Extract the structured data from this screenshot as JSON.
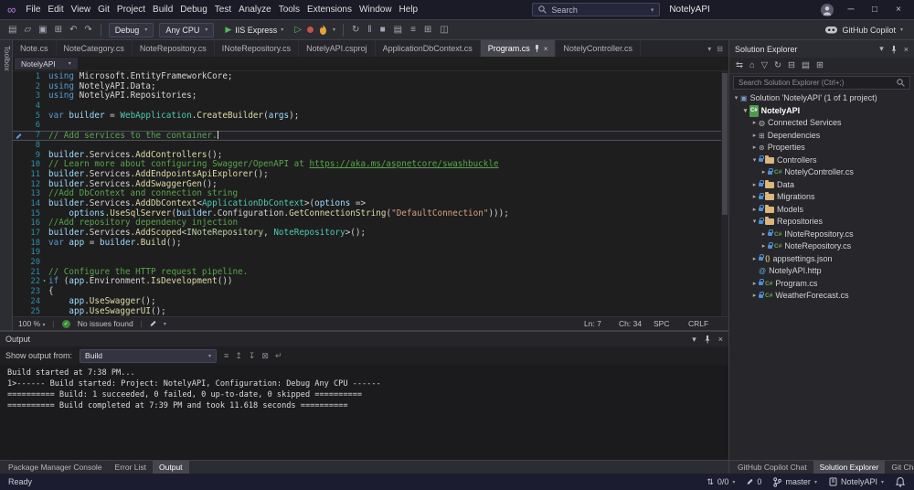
{
  "icons": {
    "chevron_down": "▾",
    "close": "×",
    "minimize": "─",
    "maximize": "□",
    "play": "▶",
    "play_outline": "▷",
    "check": "✓",
    "updown": "⇅"
  },
  "title_bar": {
    "menus": [
      "File",
      "Edit",
      "View",
      "Git",
      "Project",
      "Build",
      "Debug",
      "Test",
      "Analyze",
      "Tools",
      "Extensions",
      "Window",
      "Help"
    ],
    "search_placeholder": "Search",
    "app_title": "NotelyAPI"
  },
  "toolbar": {
    "left_icons": [
      {
        "name": "new-file-icon",
        "glyph": "▤"
      },
      {
        "name": "open-file-icon",
        "glyph": "▱"
      },
      {
        "name": "save-icon",
        "glyph": "▣"
      },
      {
        "name": "save-all-icon",
        "glyph": "⊞"
      },
      {
        "name": "undo-icon",
        "glyph": "↶"
      },
      {
        "name": "redo-icon",
        "glyph": "↷"
      }
    ],
    "config": "Debug",
    "platform": "Any CPU",
    "run_label": "IIS Express",
    "mid_icons": [
      {
        "name": "restart-icon",
        "glyph": "↻"
      },
      {
        "name": "break-all-icon",
        "glyph": "‖"
      },
      {
        "name": "stop-icon",
        "glyph": "■"
      },
      {
        "name": "show-output-icon",
        "glyph": "▤"
      },
      {
        "name": "line-structure-icon",
        "glyph": "≡"
      },
      {
        "name": "expand-icon",
        "glyph": "⊞"
      },
      {
        "name": "compare-icon",
        "glyph": "◫"
      }
    ],
    "copilot_label": "GitHub Copilot"
  },
  "left_strip": {
    "label": "Toolbox"
  },
  "editor": {
    "tabs": [
      {
        "label": "Note.cs",
        "active": false
      },
      {
        "label": "NoteCategory.cs",
        "active": false
      },
      {
        "label": "NoteRepository.cs",
        "active": false
      },
      {
        "label": "INoteRepository.cs",
        "active": false
      },
      {
        "label": "NotelyAPI.csproj",
        "active": false
      },
      {
        "label": "ApplicationDbContext.cs",
        "active": false
      },
      {
        "label": "Program.cs",
        "active": true
      },
      {
        "label": "NotelyController.cs",
        "active": false
      }
    ],
    "breadcrumb": "NotelyAPI",
    "current_line": 7,
    "fold_line": 22,
    "lines": [
      [
        [
          "k",
          "using "
        ],
        [
          "p",
          "Microsoft.EntityFrameworkCore;"
        ]
      ],
      [
        [
          "k",
          "using "
        ],
        [
          "p",
          "NotelyAPI.Data;"
        ]
      ],
      [
        [
          "k",
          "using "
        ],
        [
          "p",
          "NotelyAPI.Repositories;"
        ]
      ],
      [],
      [
        [
          "k",
          "var "
        ],
        [
          "v",
          "builder"
        ],
        [
          "p",
          " = "
        ],
        [
          "t",
          "WebApplication"
        ],
        [
          "p",
          "."
        ],
        [
          "m",
          "CreateBuilder"
        ],
        [
          "p",
          "("
        ],
        [
          "v",
          "args"
        ],
        [
          "p",
          ");"
        ]
      ],
      [],
      [
        [
          "c",
          "// Add services to the container."
        ]
      ],
      [],
      [
        [
          "v",
          "builder"
        ],
        [
          "p",
          ".Services."
        ],
        [
          "m",
          "AddControllers"
        ],
        [
          "p",
          "();"
        ]
      ],
      [
        [
          "c",
          "// Learn more about configuring Swagger/OpenAPI at "
        ],
        [
          "u",
          "https://aka.ms/aspnetcore/swashbuckle"
        ]
      ],
      [
        [
          "v",
          "builder"
        ],
        [
          "p",
          ".Services."
        ],
        [
          "m",
          "AddEndpointsApiExplorer"
        ],
        [
          "p",
          "();"
        ]
      ],
      [
        [
          "v",
          "builder"
        ],
        [
          "p",
          ".Services."
        ],
        [
          "m",
          "AddSwaggerGen"
        ],
        [
          "p",
          "();"
        ]
      ],
      [
        [
          "c",
          "//Add DbContext and connection string"
        ]
      ],
      [
        [
          "v",
          "builder"
        ],
        [
          "p",
          ".Services."
        ],
        [
          "m",
          "AddDbContext"
        ],
        [
          "p",
          "<"
        ],
        [
          "t",
          "ApplicationDbContext"
        ],
        [
          "p",
          ">("
        ],
        [
          "v",
          "options"
        ],
        [
          "p",
          " =>"
        ]
      ],
      [
        [
          "p",
          "    "
        ],
        [
          "v",
          "options"
        ],
        [
          "p",
          "."
        ],
        [
          "m",
          "UseSqlServer"
        ],
        [
          "p",
          "("
        ],
        [
          "v",
          "builder"
        ],
        [
          "p",
          ".Configuration."
        ],
        [
          "m",
          "GetConnectionString"
        ],
        [
          "p",
          "("
        ],
        [
          "s",
          "\"DefaultConnection\""
        ],
        [
          "p",
          ")));"
        ]
      ],
      [
        [
          "c",
          "//Add repository dependency injection"
        ]
      ],
      [
        [
          "v",
          "builder"
        ],
        [
          "p",
          ".Services."
        ],
        [
          "m",
          "AddScoped"
        ],
        [
          "p",
          "<"
        ],
        [
          "i",
          "INoteRepository"
        ],
        [
          "p",
          ", "
        ],
        [
          "t",
          "NoteRepository"
        ],
        [
          "p",
          ">();"
        ]
      ],
      [
        [
          "k",
          "var "
        ],
        [
          "v",
          "app"
        ],
        [
          "p",
          " = "
        ],
        [
          "v",
          "builder"
        ],
        [
          "p",
          "."
        ],
        [
          "m",
          "Build"
        ],
        [
          "p",
          "();"
        ]
      ],
      [],
      [],
      [
        [
          "c",
          "// Configure the HTTP request pipeline."
        ]
      ],
      [
        [
          "k",
          "if "
        ],
        [
          "p",
          "("
        ],
        [
          "v",
          "app"
        ],
        [
          "p",
          ".Environment."
        ],
        [
          "m",
          "IsDevelopment"
        ],
        [
          "p",
          "())"
        ]
      ],
      [
        [
          "p",
          "{"
        ]
      ],
      [
        [
          "p",
          "    "
        ],
        [
          "v",
          "app"
        ],
        [
          "p",
          "."
        ],
        [
          "m",
          "UseSwagger"
        ],
        [
          "p",
          "();"
        ]
      ],
      [
        [
          "p",
          "    "
        ],
        [
          "v",
          "app"
        ],
        [
          "p",
          "."
        ],
        [
          "m",
          "UseSwaggerUI"
        ],
        [
          "p",
          "();"
        ]
      ]
    ],
    "status": {
      "zoom": "100 %",
      "health": "No issues found",
      "ln": "Ln: 7",
      "ch": "Ch: 34",
      "spc": "SPC",
      "eol": "CRLF"
    }
  },
  "output": {
    "title": "Output",
    "show_output_from": "Show output from:",
    "source": "Build",
    "toolbar_icons": [
      {
        "name": "find-message-icon",
        "glyph": "≡"
      },
      {
        "name": "go-prev-message-icon",
        "glyph": "↥"
      },
      {
        "name": "go-next-message-icon",
        "glyph": "↧"
      },
      {
        "name": "clear-all-icon",
        "glyph": "⊠"
      },
      {
        "name": "word-wrap-icon",
        "glyph": "↵"
      }
    ],
    "lines": [
      "Build started at 7:38 PM...",
      "1>------ Build started: Project: NotelyAPI, Configuration: Debug Any CPU ------",
      "========== Build: 1 succeeded, 0 failed, 0 up-to-date, 0 skipped ==========",
      "========== Build completed at 7:39 PM and took 11.618 seconds =========="
    ]
  },
  "bottom_tabs_left": [
    {
      "label": "Package Manager Console",
      "active": false
    },
    {
      "label": "Error List",
      "active": false
    },
    {
      "label": "Output",
      "active": true
    }
  ],
  "bottom_tabs_right": [
    {
      "label": "GitHub Copilot Chat",
      "active": false
    },
    {
      "label": "Solution Explorer",
      "active": true
    },
    {
      "label": "Git Changes",
      "active": false
    }
  ],
  "solution_explorer": {
    "title": "Solution Explorer",
    "search_placeholder": "Search Solution Explorer (Ctrl+;)",
    "toolbar_icons": [
      {
        "name": "switch-views-icon",
        "glyph": "⇆"
      },
      {
        "name": "home-icon",
        "glyph": "⌂"
      },
      {
        "name": "filter-icon",
        "glyph": "▽"
      },
      {
        "name": "refresh-icon",
        "glyph": "↻"
      },
      {
        "name": "collapse-all-icon",
        "glyph": "⊟"
      },
      {
        "name": "show-all-files-icon",
        "glyph": "▤"
      },
      {
        "name": "properties-icon",
        "glyph": "⊞"
      }
    ],
    "tree": [
      {
        "depth": 0,
        "arrow": "down",
        "icon": "solution",
        "label": "Solution 'NotelyAPI' (1 of 1 project)",
        "bold": false,
        "lock": false
      },
      {
        "depth": 1,
        "arrow": "down",
        "icon": "project",
        "label": "NotelyAPI",
        "bold": true,
        "lock": false
      },
      {
        "depth": 2,
        "arrow": "right",
        "icon": "plug",
        "label": "Connected Services",
        "bold": false,
        "lock": false
      },
      {
        "depth": 2,
        "arrow": "right",
        "icon": "deps",
        "label": "Dependencies",
        "bold": false,
        "lock": false
      },
      {
        "depth": 2,
        "arrow": "right",
        "icon": "props",
        "label": "Properties",
        "bold": false,
        "lock": false
      },
      {
        "depth": 2,
        "arrow": "down",
        "icon": "folder",
        "label": "Controllers",
        "bold": false,
        "lock": true
      },
      {
        "depth": 3,
        "arrow": "right",
        "icon": "cs",
        "label": "NotelyController.cs",
        "bold": false,
        "lock": true
      },
      {
        "depth": 2,
        "arrow": "right",
        "icon": "folder",
        "label": "Data",
        "bold": false,
        "lock": true
      },
      {
        "depth": 2,
        "arrow": "right",
        "icon": "folder",
        "label": "Migrations",
        "bold": false,
        "lock": true
      },
      {
        "depth": 2,
        "arrow": "right",
        "icon": "folder",
        "label": "Models",
        "bold": false,
        "lock": true
      },
      {
        "depth": 2,
        "arrow": "down",
        "icon": "folder",
        "label": "Repositories",
        "bold": false,
        "lock": true
      },
      {
        "depth": 3,
        "arrow": "right",
        "icon": "cs",
        "label": "INoteRepository.cs",
        "bold": false,
        "lock": true
      },
      {
        "depth": 3,
        "arrow": "right",
        "icon": "cs",
        "label": "NoteRepository.cs",
        "bold": false,
        "lock": true
      },
      {
        "depth": 2,
        "arrow": "right",
        "icon": "json",
        "label": "appsettings.json",
        "bold": false,
        "lock": true
      },
      {
        "depth": 2,
        "arrow": "none",
        "icon": "http",
        "label": "NotelyAPI.http",
        "bold": false,
        "lock": false
      },
      {
        "depth": 2,
        "arrow": "right",
        "icon": "cs",
        "label": "Program.cs",
        "bold": false,
        "lock": true
      },
      {
        "depth": 2,
        "arrow": "right",
        "icon": "cs",
        "label": "WeatherForecast.cs",
        "bold": false,
        "lock": true
      }
    ]
  },
  "status_bar": {
    "ready": "Ready",
    "updown": "0/0",
    "pencil_count": "0",
    "branch": "master",
    "repo": "NotelyAPI"
  }
}
